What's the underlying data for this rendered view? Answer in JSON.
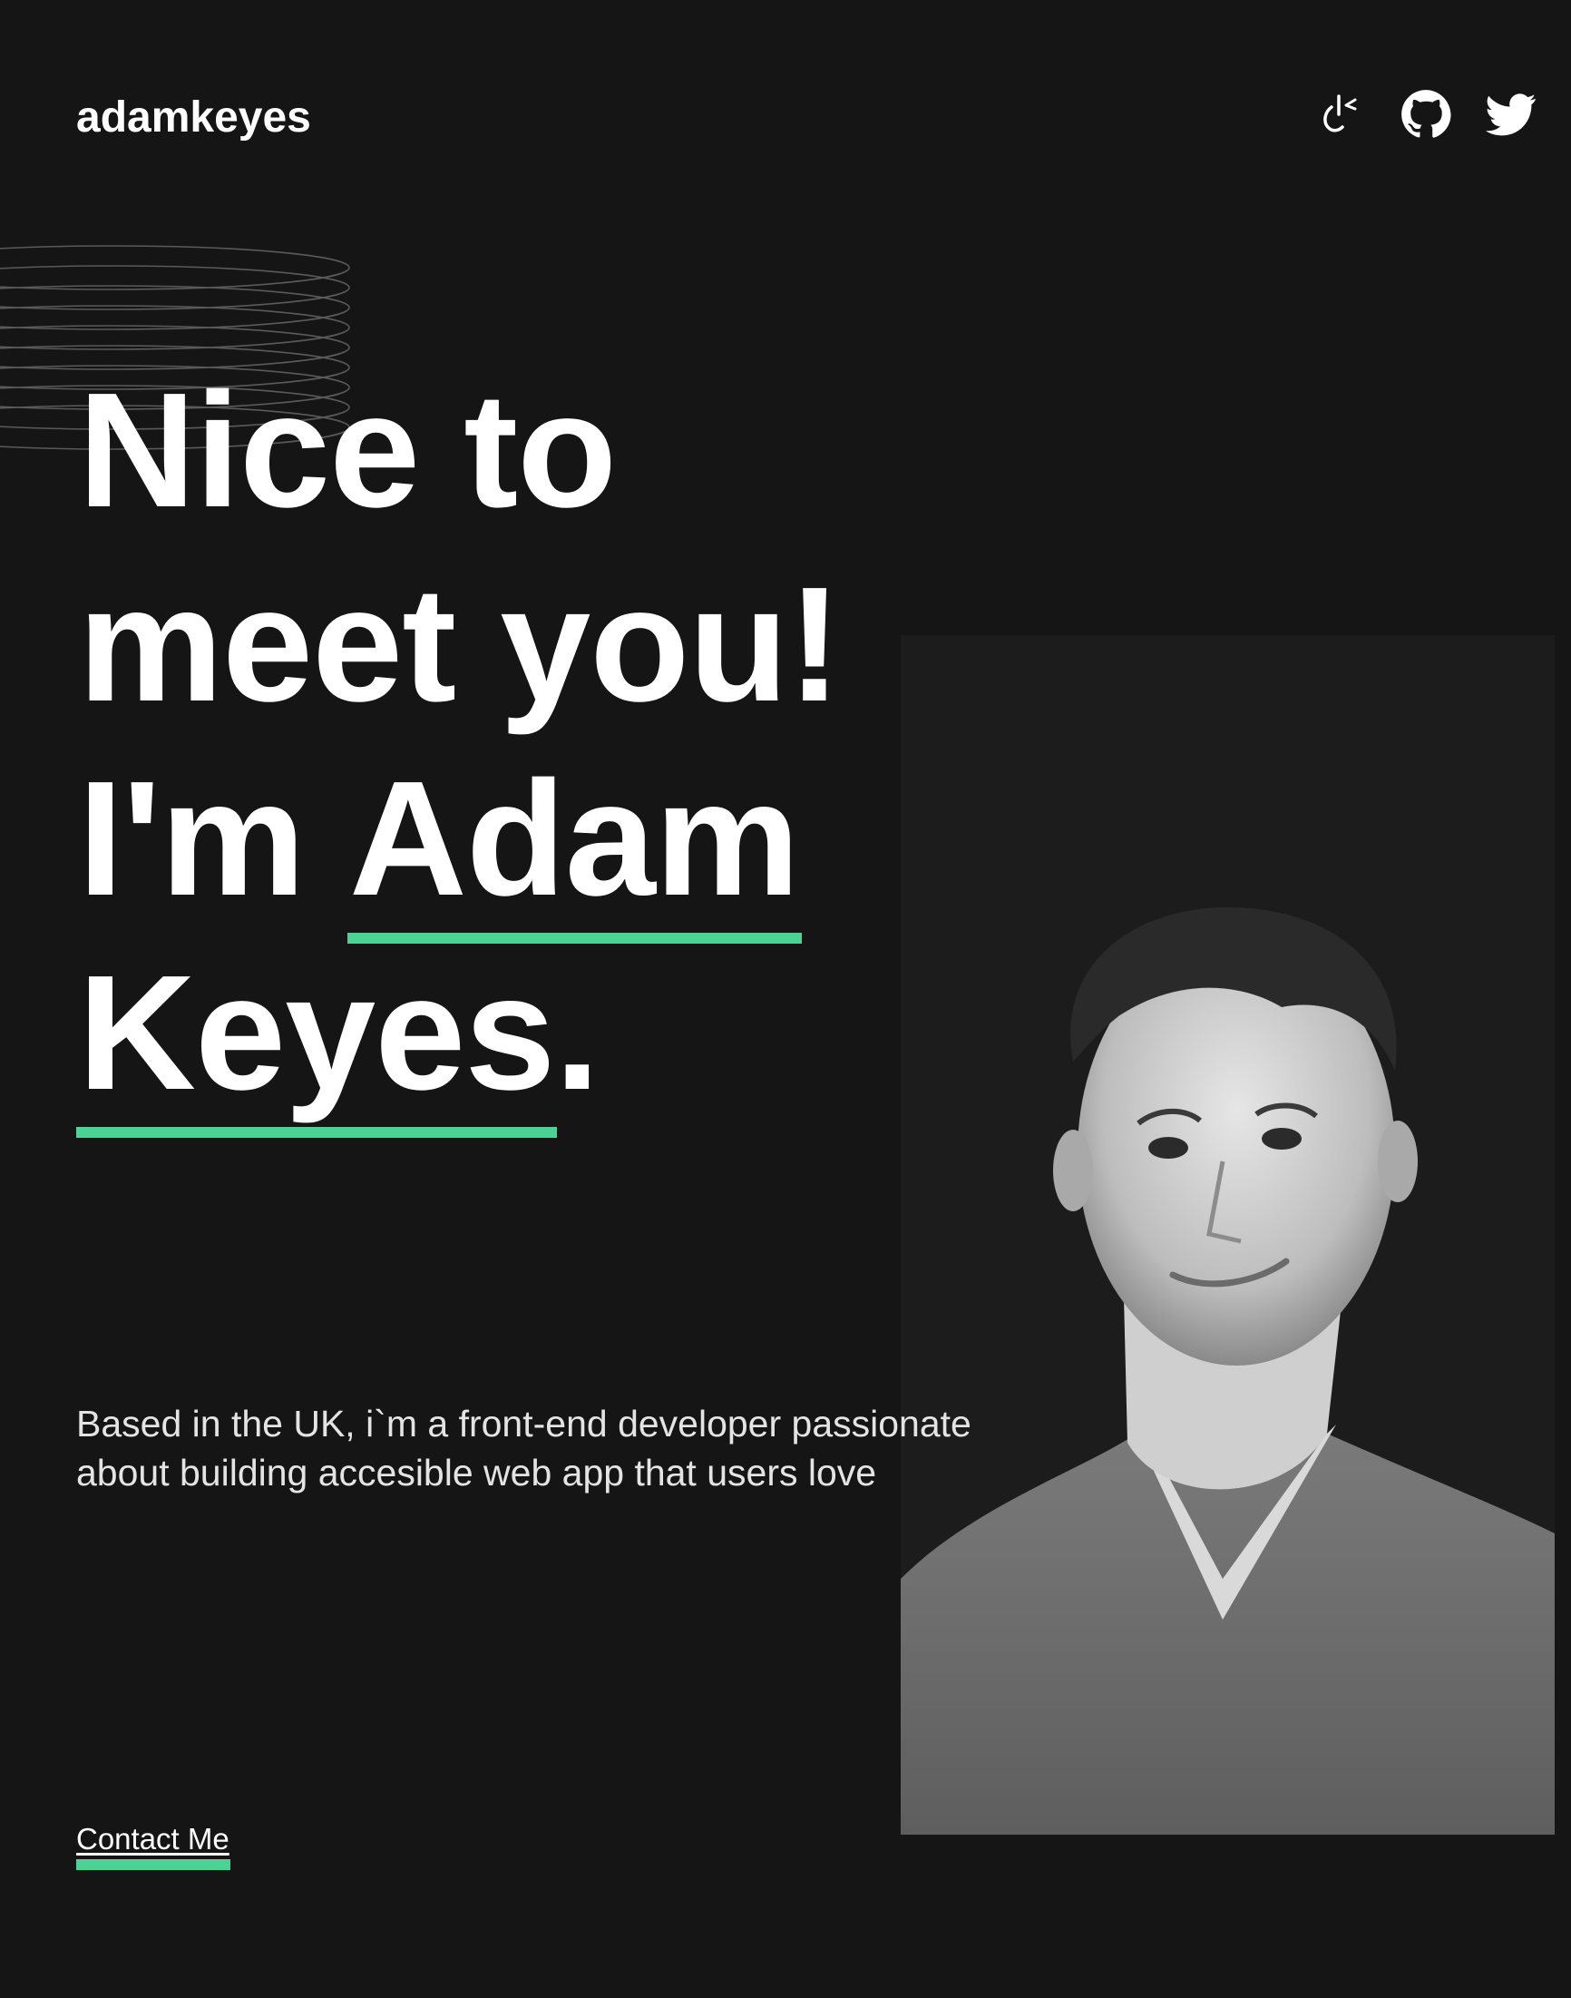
{
  "header": {
    "logo": "adamkeyes",
    "social_icons": [
      "codepen-icon",
      "github-icon",
      "twitter-icon"
    ]
  },
  "hero": {
    "line1": "Nice to",
    "line2": "meet you!",
    "line3_prefix": "I'm ",
    "name_first": "Adam",
    "name_last": "Keyes",
    "period": ".",
    "intro": "Based in the UK, i`m a front-end developer passionate about building accesible web app that users love",
    "contact_label": "Contact Me"
  },
  "colors": {
    "background": "#151515",
    "accent": "#4ad394",
    "text": "#ffffff"
  }
}
